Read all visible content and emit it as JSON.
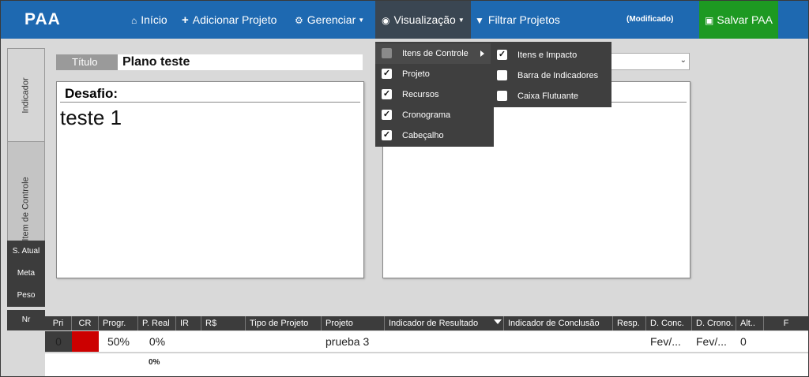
{
  "app": {
    "brand": "PAA"
  },
  "nav": {
    "inicio": {
      "icon": "home-icon",
      "label": "Início"
    },
    "adicionar": {
      "icon": "plus-icon",
      "label": "Adicionar Projeto"
    },
    "gerenciar": {
      "icon": "gears-icon",
      "label": "Gerenciar"
    },
    "visualizacao": {
      "icon": "eye-icon",
      "label": "Visualização"
    },
    "filtrar": {
      "icon": "filter-icon",
      "label": "Filtrar Projetos"
    }
  },
  "status": {
    "modified": "(Modificado)"
  },
  "save": {
    "icon": "save-icon",
    "label": "Salvar PAA"
  },
  "sidebar": {
    "tabs": [
      {
        "label": "Indicador"
      },
      {
        "label": "Item de Controle"
      }
    ],
    "row_labels": [
      "S. Atual",
      "Meta",
      "Peso",
      "Nr"
    ]
  },
  "form": {
    "title_label": "Título",
    "title_value": "Plano teste"
  },
  "desafio": {
    "header": "Desafio:",
    "text": "teste 1"
  },
  "menu": {
    "items": [
      {
        "label": "Itens de Controle",
        "checked": false,
        "has_submenu": true
      },
      {
        "label": "Projeto",
        "checked": true
      },
      {
        "label": "Recursos",
        "checked": true
      },
      {
        "label": "Cronograma",
        "checked": true
      },
      {
        "label": "Cabeçalho",
        "checked": true
      }
    ],
    "submenu": [
      {
        "label": "Itens e Impacto",
        "checked": true
      },
      {
        "label": "Barra de Indicadores",
        "checked": false
      },
      {
        "label": "Caixa Flutuante",
        "checked": false
      }
    ]
  },
  "table": {
    "headers": [
      "Pri",
      "CR",
      "Progr.",
      "P. Real",
      "IR",
      "R$",
      "Tipo de Projeto",
      "Projeto",
      "Indicador de Resultado",
      "Indicador de Conclusão",
      "Resp.",
      "D. Conc.",
      "D. Crono.",
      "Alt..",
      "F"
    ],
    "row": {
      "pri": "0",
      "cr": "",
      "progr": "50%",
      "p_real": "0%",
      "ir": "",
      "rs": "",
      "tipo": "",
      "projeto": "prueba 3",
      "ind_res": "",
      "ind_conc": "",
      "resp": "",
      "d_conc": "Fev/...",
      "d_crono": "Fev/...",
      "alt": "0"
    },
    "footer_p_real": "0%",
    "cr_color": "#cc0000"
  },
  "colors": {
    "topbar": "#1e69b1",
    "save": "#1d9922",
    "menu": "#3f3f3f"
  }
}
